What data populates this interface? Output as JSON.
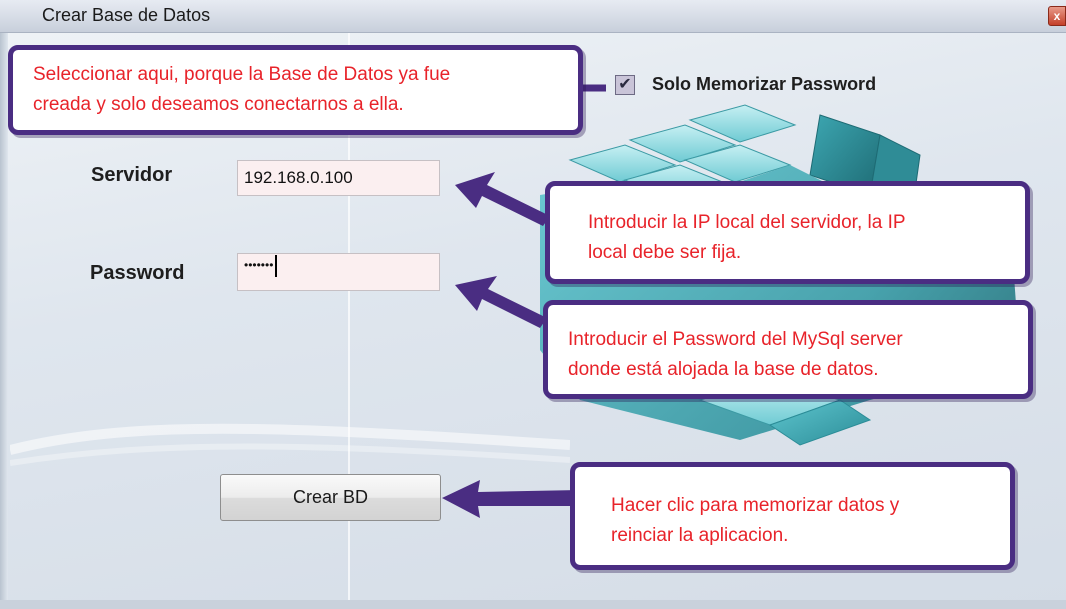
{
  "window": {
    "title": "Crear Base de Datos",
    "close_glyph": "x"
  },
  "form": {
    "checkbox_label": "Solo Memorizar Password",
    "checkbox_checked": true,
    "servidor_label": "Servidor",
    "servidor_value": "192.168.0.100",
    "password_label": "Password",
    "password_value": "•••••••",
    "create_button": "Crear BD"
  },
  "callouts": {
    "top": {
      "line1": "Seleccionar aqui, porque la Base de Datos ya fue",
      "line2": "creada y solo deseamos conectarnos a ella."
    },
    "ip": {
      "line1": "Introducir la IP local del servidor, la IP",
      "line2": "local debe ser fija."
    },
    "password": {
      "line1": "Introducir el Password del MySql server",
      "line2": "donde está alojada la base de datos."
    },
    "button": {
      "line1": "Hacer clic para memorizar datos y",
      "line2": "reinciar la aplicacion."
    }
  },
  "colors": {
    "callout_border": "#4a2d82",
    "callout_text": "#e8232a",
    "cube": "#5fc6cf"
  }
}
